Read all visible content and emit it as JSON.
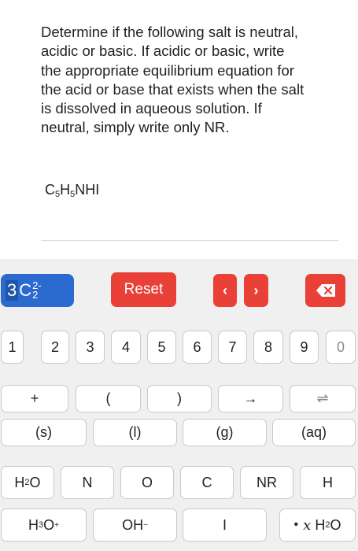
{
  "question": {
    "text": "Determine if the following salt is neutral, acidic or basic. If acidic or basic, write the appropriate equilibrium equation for the acid or base that exists when the salt is dissolved in aqueous solution. If neutral, simply write only NR.",
    "formula_parts": [
      "C",
      "5",
      "H",
      "5",
      "NHI"
    ]
  },
  "toolbar": {
    "preview": {
      "coefficient": "3",
      "element": "C",
      "charge": "2-",
      "subscript": "2"
    },
    "reset_label": "Reset",
    "nav_left": "‹",
    "nav_right": "›",
    "backspace_icon": "backspace-x-icon",
    "accent_red": "#e94038",
    "accent_blue": "#2b6bd0"
  },
  "digits": [
    "1",
    "2",
    "3",
    "4",
    "5",
    "6",
    "7",
    "8",
    "9",
    "0"
  ],
  "symbols": [
    "+",
    "(",
    ")",
    "→",
    "⇌"
  ],
  "states": [
    "(s)",
    "(l)",
    "(g)",
    "(aq)"
  ],
  "elements": [
    "N",
    "O",
    "C",
    "NR",
    "H"
  ],
  "species": {
    "water": {
      "main": "H",
      "sub": "2",
      "end": "O"
    },
    "hydronium": {
      "main": "H",
      "sub": "3",
      "end": "O",
      "sup": "+"
    },
    "hydroxide": {
      "main": "OH",
      "sup": "−"
    },
    "iodine": "I",
    "hydrate": {
      "dot": "•",
      "x": "x",
      "main": "H",
      "sub": "2",
      "end": "O"
    }
  }
}
